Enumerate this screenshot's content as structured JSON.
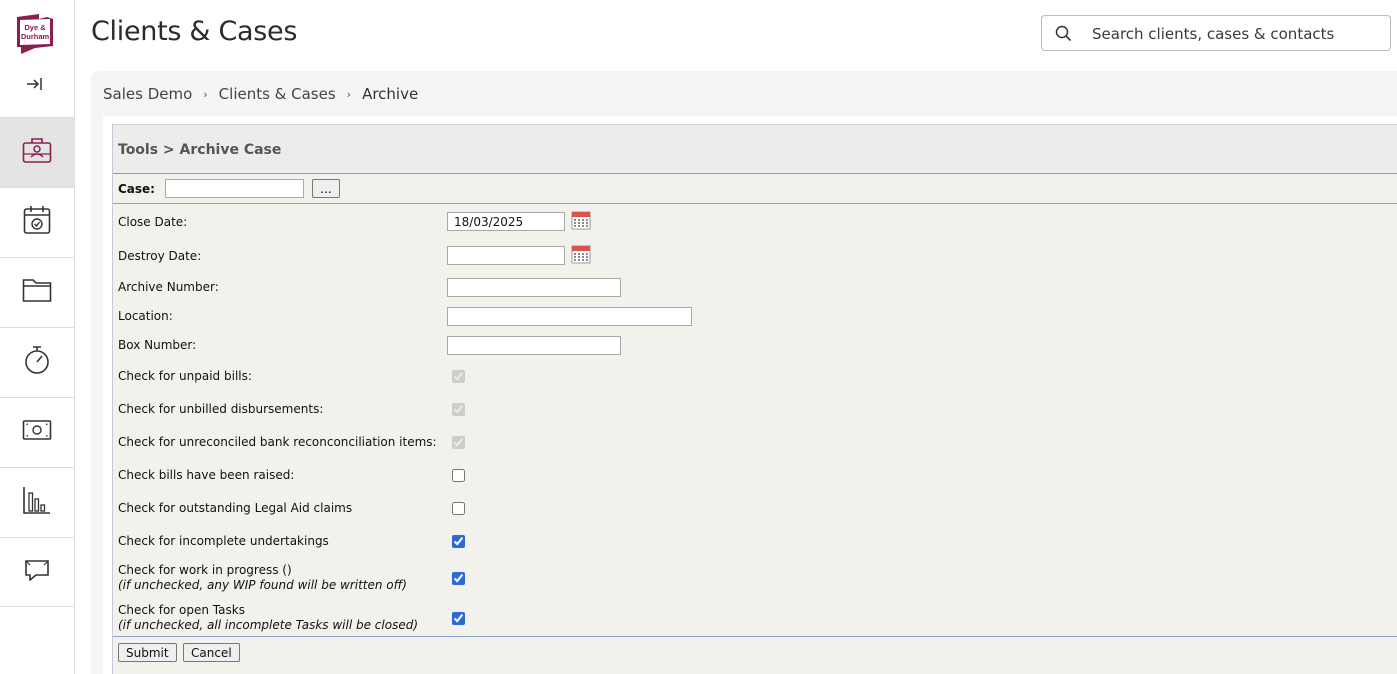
{
  "app": {
    "logo_text_line1": "Dye &",
    "logo_text_line2": "Durham",
    "brand_color": "#8b1e4f"
  },
  "header": {
    "title": "Clients & Cases",
    "search_placeholder": "Search clients, cases & contacts"
  },
  "sidebar": {
    "items": [
      {
        "name": "briefcase-icon",
        "active": true
      },
      {
        "name": "calendar-icon",
        "active": false
      },
      {
        "name": "folder-icon",
        "active": false
      },
      {
        "name": "stopwatch-icon",
        "active": false
      },
      {
        "name": "money-icon",
        "active": false
      },
      {
        "name": "bar-chart-icon",
        "active": false
      },
      {
        "name": "chat-icon",
        "active": false
      }
    ]
  },
  "breadcrumb": {
    "items": [
      "Sales Demo",
      "Clients & Cases",
      "Archive"
    ]
  },
  "form": {
    "title": "Tools > Archive Case",
    "case_label": "Case:",
    "case_value": "",
    "case_browse_label": "...",
    "close_date_label": "Close Date:",
    "close_date_value": "18/03/2025",
    "destroy_date_label": "Destroy Date:",
    "destroy_date_value": "",
    "archive_number_label": "Archive Number:",
    "location_label": "Location:",
    "box_number_label": "Box Number:",
    "checks": [
      {
        "label": "Check for unpaid bills:",
        "note": "",
        "checked": true,
        "disabled": true
      },
      {
        "label": "Check for unbilled disbursements:",
        "note": "",
        "checked": true,
        "disabled": true
      },
      {
        "label": "Check for unreconciled bank reconconciliation items:",
        "note": "",
        "checked": true,
        "disabled": true
      },
      {
        "label": "Check bills have been raised:",
        "note": "",
        "checked": false,
        "disabled": false
      },
      {
        "label": "Check for outstanding Legal Aid claims",
        "note": "",
        "checked": false,
        "disabled": false
      },
      {
        "label": "Check for incomplete undertakings",
        "note": "",
        "checked": true,
        "disabled": false
      },
      {
        "label": "Check for work in progress ()",
        "note": "(if unchecked, any WIP found will be written off)",
        "checked": true,
        "disabled": false
      },
      {
        "label": "Check for open Tasks",
        "note": "(if unchecked, all incomplete Tasks will be closed)",
        "checked": true,
        "disabled": false
      }
    ],
    "submit_label": "Submit",
    "cancel_label": "Cancel"
  }
}
